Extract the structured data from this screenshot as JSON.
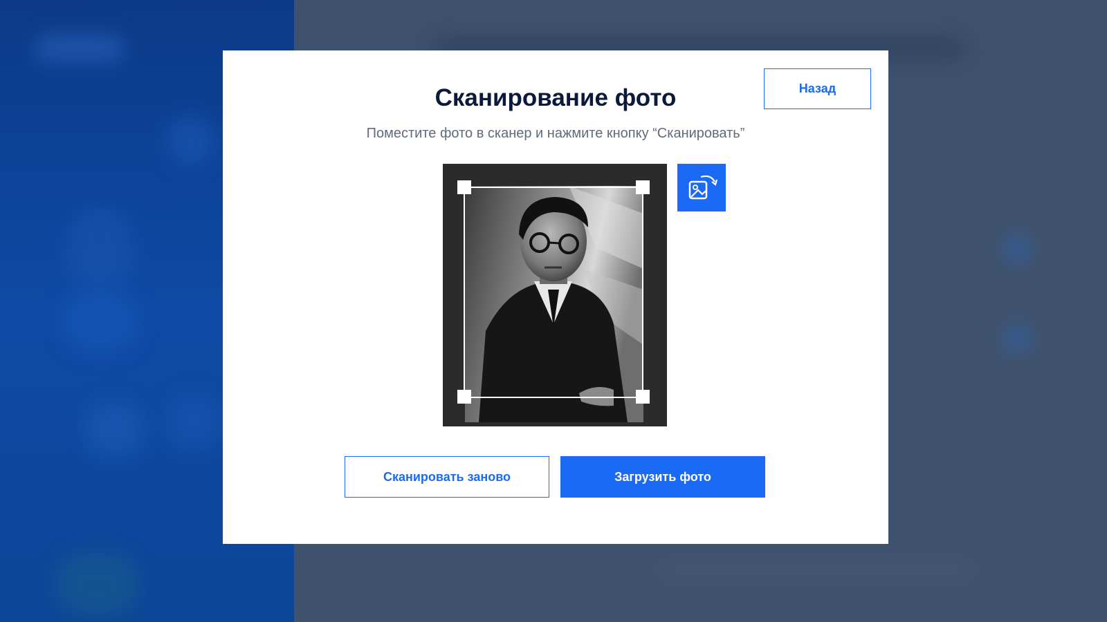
{
  "dialog": {
    "title": "Сканирование фото",
    "subtitle": "Поместите фото в сканер и нажмите кнопку “Сканировать”",
    "back_label": "Назад",
    "rescan_label": "Сканировать заново",
    "upload_label": "Загрузить фото"
  },
  "icons": {
    "rotate": "rotate-image-icon"
  },
  "colors": {
    "accent": "#1a6af5",
    "title": "#0b1a3a",
    "subtitle": "#5f6b7a",
    "overlay_bg": "#3f526d",
    "sidebar_bg": "#0e4aa6"
  }
}
